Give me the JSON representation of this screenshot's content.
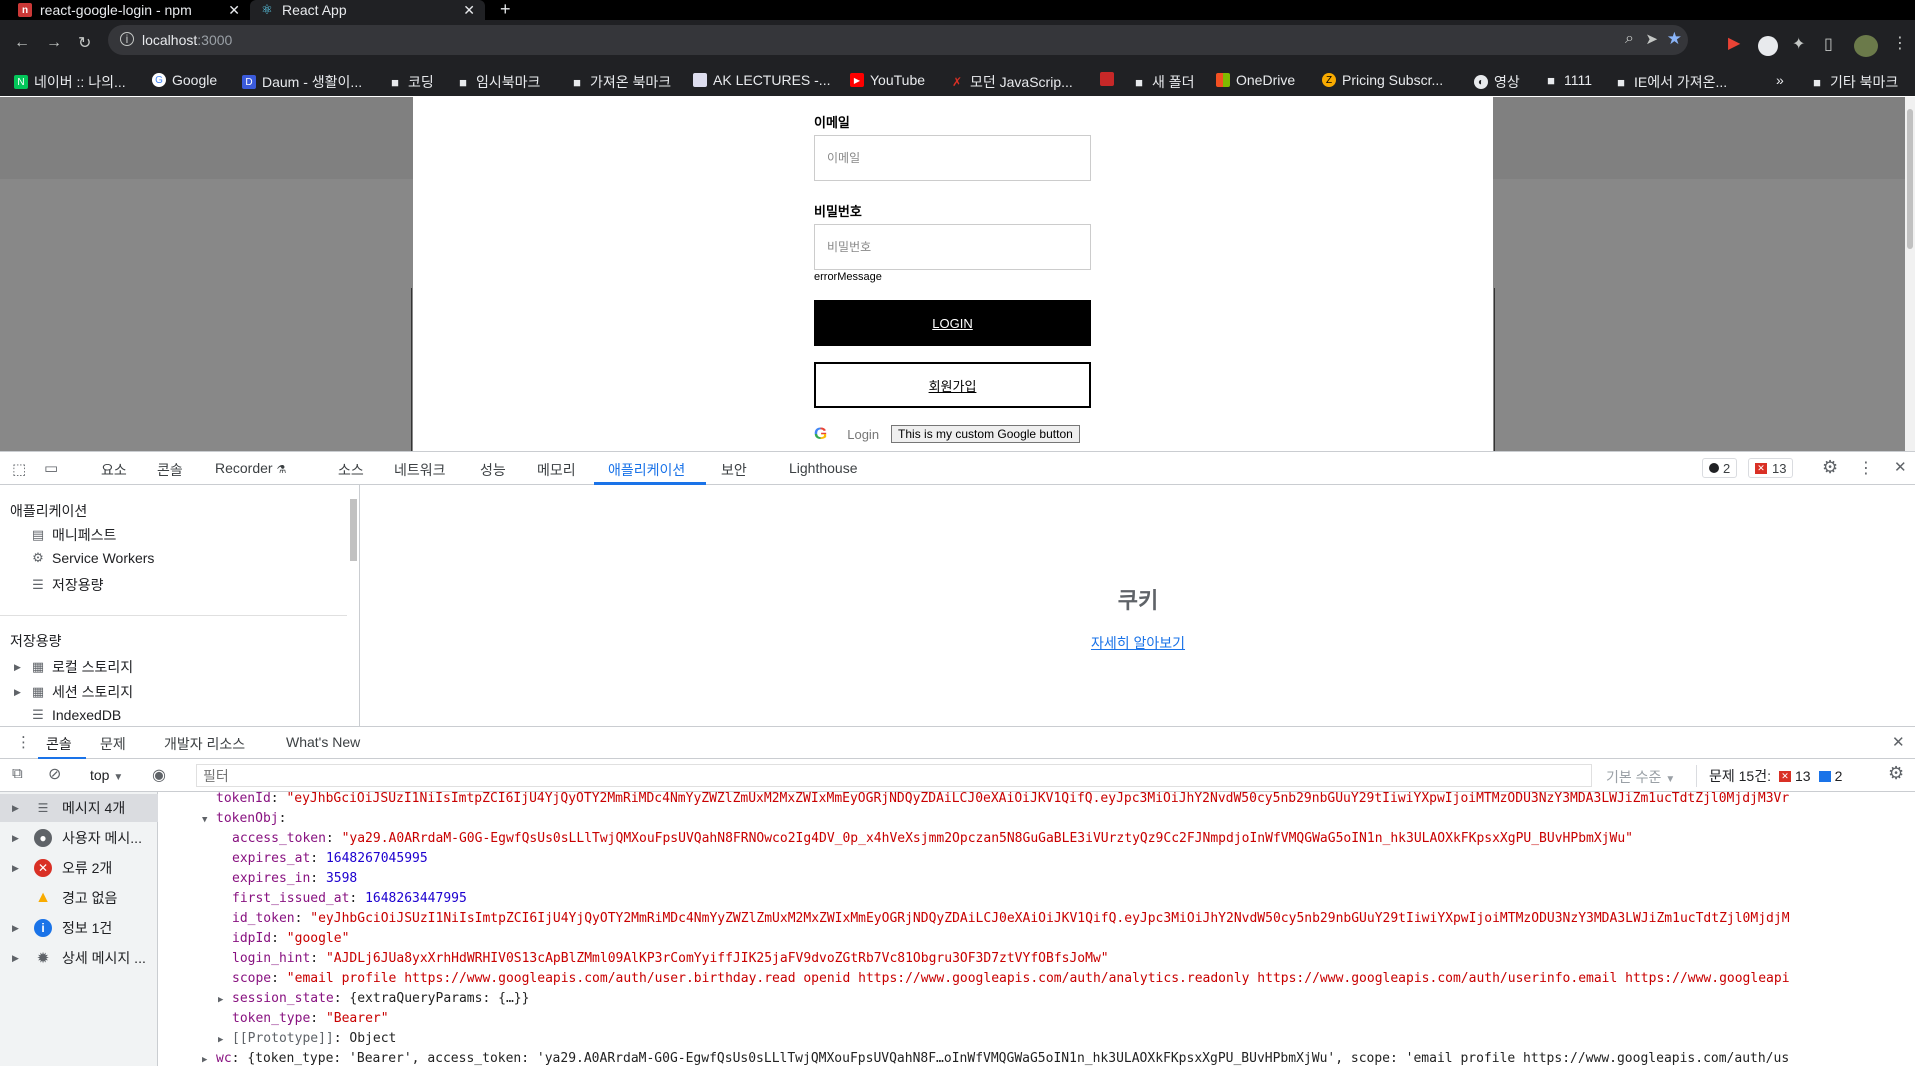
{
  "browser": {
    "tabs": [
      {
        "title": "react-google-login - npm",
        "active": false
      },
      {
        "title": "React App",
        "active": true
      }
    ],
    "url_host": "localhost",
    "url_port": ":3000",
    "bookmarks": [
      "네이버 :: 나의...",
      "Google",
      "Daum - 생활이...",
      "코딩",
      "임시북마크",
      "가져온 북마크",
      "AK LECTURES -...",
      "YouTube",
      "모던 JavaScrip...",
      "새 폴더",
      "OneDrive",
      "Pricing Subscr...",
      "영상",
      "1111",
      "IE에서 가져온...",
      "»",
      "기타 북마크"
    ]
  },
  "page": {
    "email_label": "이메일",
    "email_placeholder": "이메일",
    "password_label": "비밀번호",
    "password_placeholder": "비밀번호",
    "error_message": "errorMessage",
    "login_button": "LOGIN",
    "signup_button": "회원가입",
    "google_login_text": "Login",
    "custom_google_button": "This is my custom Google button"
  },
  "devtools": {
    "tabs": [
      "요소",
      "콘솔",
      "Recorder",
      "소스",
      "네트워크",
      "성능",
      "메모리",
      "애플리케이션",
      "보안",
      "Lighthouse"
    ],
    "active_tab": "애플리케이션",
    "issues_count": "2",
    "errors_count": "13",
    "app_sidebar": {
      "section1": "애플리케이션",
      "items1": [
        "매니페스트",
        "Service Workers",
        "저장용량"
      ],
      "section2": "저장용량",
      "items2": [
        "로컬 스토리지",
        "세션 스토리지",
        "IndexedDB"
      ]
    },
    "app_main": {
      "title": "쿠키",
      "link": "자세히 알아보기"
    },
    "drawer_tabs": [
      "콘솔",
      "문제",
      "개발자 리소스",
      "What's New"
    ],
    "console_toolbar": {
      "context": "top",
      "filter_placeholder": "필터",
      "level": "기본 수준",
      "issues_label": "문제 15건:",
      "issues_errors": "13",
      "issues_info": "2"
    },
    "console_sidebar": [
      {
        "label": "메시지 4개",
        "icon": "list-icon"
      },
      {
        "label": "사용자 메시...",
        "icon": "user-icon"
      },
      {
        "label": "오류 2개",
        "icon": "error-icon"
      },
      {
        "label": "경고 없음",
        "icon": "warning-icon"
      },
      {
        "label": "정보 1건",
        "icon": "info-icon"
      },
      {
        "label": "상세 메시지 ...",
        "icon": "verbose-icon"
      }
    ],
    "console_log": {
      "tokenId_key": "tokenId",
      "tokenId_val": "\"eyJhbGciOiJSUzI1NiIsImtpZCI6IjU4YjQyOTY2MmRiMDc4NmYyZWZlZmUxM2MxZWIxMmEyOGRjNDQyZDAiLCJ0eXAiOiJKV1QifQ.eyJpc3MiOiJhY2NvdW50cy5nb29nbGUuY29tIiwiYXpwIjoiMTMzODU3NzY3MDA3LWJiZm1ucTdtZjl0MjdjM3Vr",
      "tokenObj_key": "tokenObj",
      "access_token_key": "access_token",
      "access_token_val": "\"ya29.A0ARrdaM-G0G-EgwfQsUs0sLLlTwjQMXouFpsUVQahN8FRNOwco2Ig4DV_0p_x4hVeXsjmm2Opczan5N8GuGaBLE3iVUrztyQz9Cc2FJNmpdjoInWfVMQGWaG5oIN1n_hk3ULAOXkFKpsxXgPU_BUvHPbmXjWu\"",
      "expires_at_key": "expires_at",
      "expires_at_val": "1648267045995",
      "expires_in_key": "expires_in",
      "expires_in_val": "3598",
      "first_issued_at_key": "first_issued_at",
      "first_issued_at_val": "1648263447995",
      "id_token_key": "id_token",
      "id_token_val": "\"eyJhbGciOiJSUzI1NiIsImtpZCI6IjU4YjQyOTY2MmRiMDc4NmYyZWZlZmUxM2MxZWIxMmEyOGRjNDQyZDAiLCJ0eXAiOiJKV1QifQ.eyJpc3MiOiJhY2NvdW50cy5nb29nbGUuY29tIiwiYXpwIjoiMTMzODU3NzY3MDA3LWJiZm1ucTdtZjl0MjdjM",
      "idpId_key": "idpId",
      "idpId_val": "\"google\"",
      "login_hint_key": "login_hint",
      "login_hint_val": "\"AJDLj6JUa8yxXrhHdWRHIV0S13cApBlZMml09AlKP3rComYyiffJIK25jaFV9dvoZGtRb7Vc81Obgru3OF3D7ztVYfOBfsJoMw\"",
      "scope_key": "scope",
      "scope_val": "\"email profile https://www.googleapis.com/auth/user.birthday.read openid https://www.googleapis.com/auth/analytics.readonly https://www.googleapis.com/auth/userinfo.email https://www.googleapi",
      "session_state_key": "session_state",
      "session_state_val": "{extraQueryParams: {…}}",
      "token_type_key": "token_type",
      "token_type_val": "\"Bearer\"",
      "prototype_key": "[[Prototype]]",
      "prototype_val": "Object",
      "wc_key": "wc",
      "wc_val": "{token_type: 'Bearer', access_token: 'ya29.A0ARrdaM-G0G-EgwfQsUs0sLLlTwjQMXouFpsUVQahN8F…oInWfVMQGWaG5oIN1n_hk3ULAOXkFKpsxXgPU_BUvHPbmXjWu', scope: 'email profile https://www.googleapis.com/auth/us"
    }
  }
}
